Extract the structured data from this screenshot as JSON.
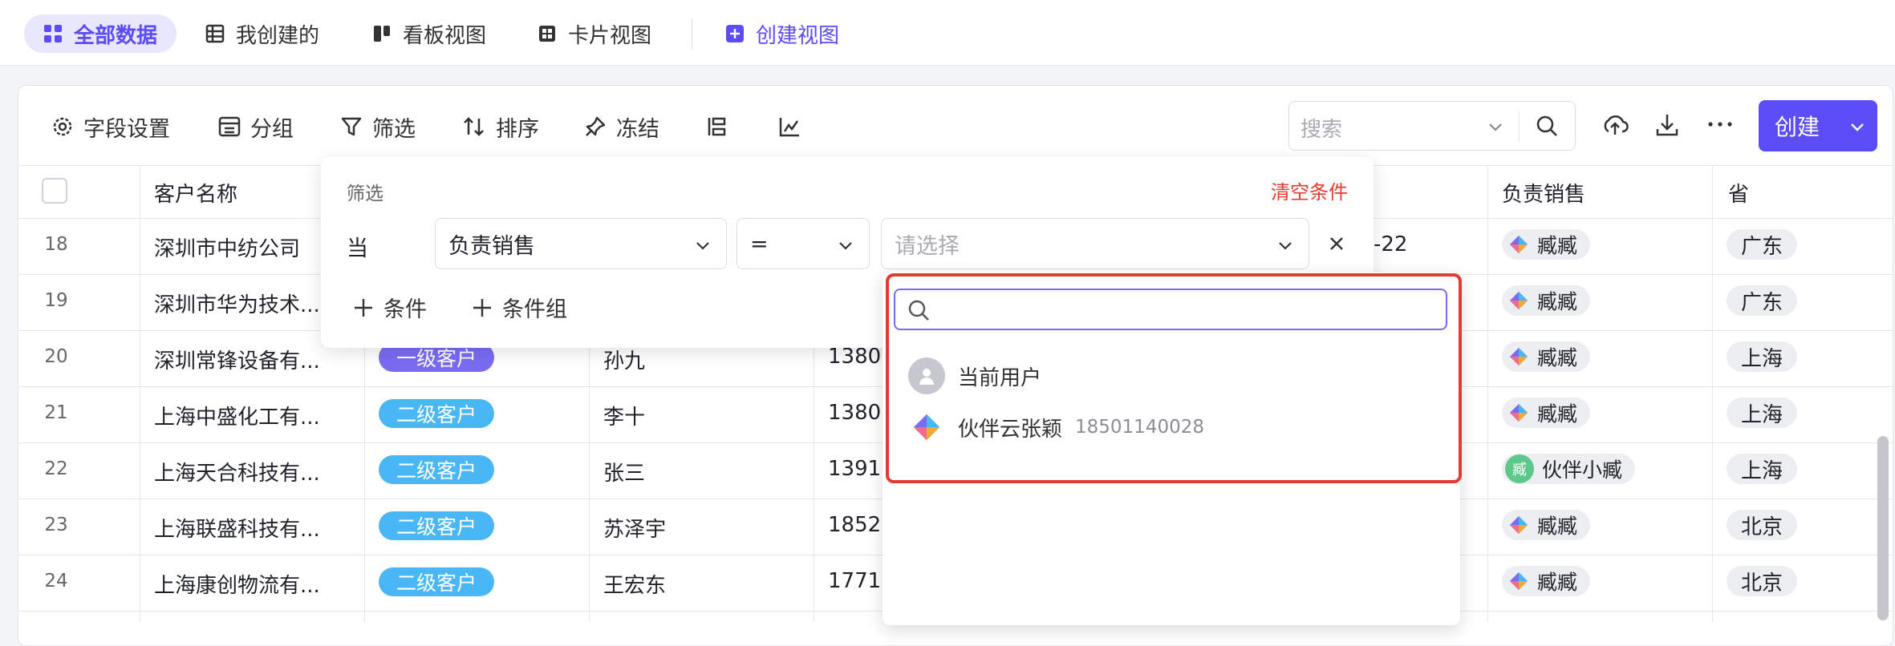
{
  "views": {
    "all": "全部数据",
    "mine": "我创建的",
    "kanban": "看板视图",
    "card": "卡片视图",
    "create": "创建视图"
  },
  "toolbar": {
    "fields": "字段设置",
    "group": "分组",
    "filter": "筛选",
    "sort": "排序",
    "freeze": "冻结",
    "search_placeholder": "搜索",
    "create": "创建"
  },
  "columns": {
    "name": "客户名称",
    "sales": "负责销售",
    "province": "省"
  },
  "rows": [
    {
      "no": "18",
      "name": "深圳市中纺公司",
      "date": "-22",
      "sales": "臧臧",
      "prov": "广东"
    },
    {
      "no": "19",
      "name": "深圳市华为技术...",
      "sales": "臧臧",
      "prov": "广东"
    },
    {
      "no": "20",
      "name": "深圳常锋设备有...",
      "level": "一级客户",
      "contact": "孙九",
      "phone": "1380",
      "sales": "臧臧",
      "prov": "上海"
    },
    {
      "no": "21",
      "name": "上海中盛化工有...",
      "level": "二级客户",
      "contact": "李十",
      "phone": "1380",
      "sales": "臧臧",
      "prov": "上海"
    },
    {
      "no": "22",
      "name": "上海天合科技有...",
      "level": "二级客户",
      "contact": "张三",
      "phone": "1391",
      "sales": "伙伴小臧",
      "sales_avatar": "臧",
      "prov": "上海"
    },
    {
      "no": "23",
      "name": "上海联盛科技有...",
      "level": "二级客户",
      "contact": "苏泽宇",
      "phone": "1852",
      "sales": "臧臧",
      "prov": "北京"
    },
    {
      "no": "24",
      "name": "上海康创物流有...",
      "level": "二级客户",
      "contact": "王宏东",
      "phone": "1771",
      "sales": "臧臧",
      "prov": "北京"
    }
  ],
  "filter": {
    "title": "筛选",
    "clear": "清空条件",
    "when": "当",
    "field": "负责销售",
    "operator": "=",
    "value_placeholder": "请选择",
    "add_condition": "条件",
    "add_group": "条件组"
  },
  "dropdown": {
    "options": [
      {
        "label": "当前用户"
      },
      {
        "label": "伙伴云张颖",
        "phone": "18501140028"
      }
    ]
  },
  "colors": {
    "accent": "#5b4cf5",
    "tag1": "#7a6cf2",
    "tag2": "#49b6f5",
    "highlight": "#e53a2f"
  }
}
